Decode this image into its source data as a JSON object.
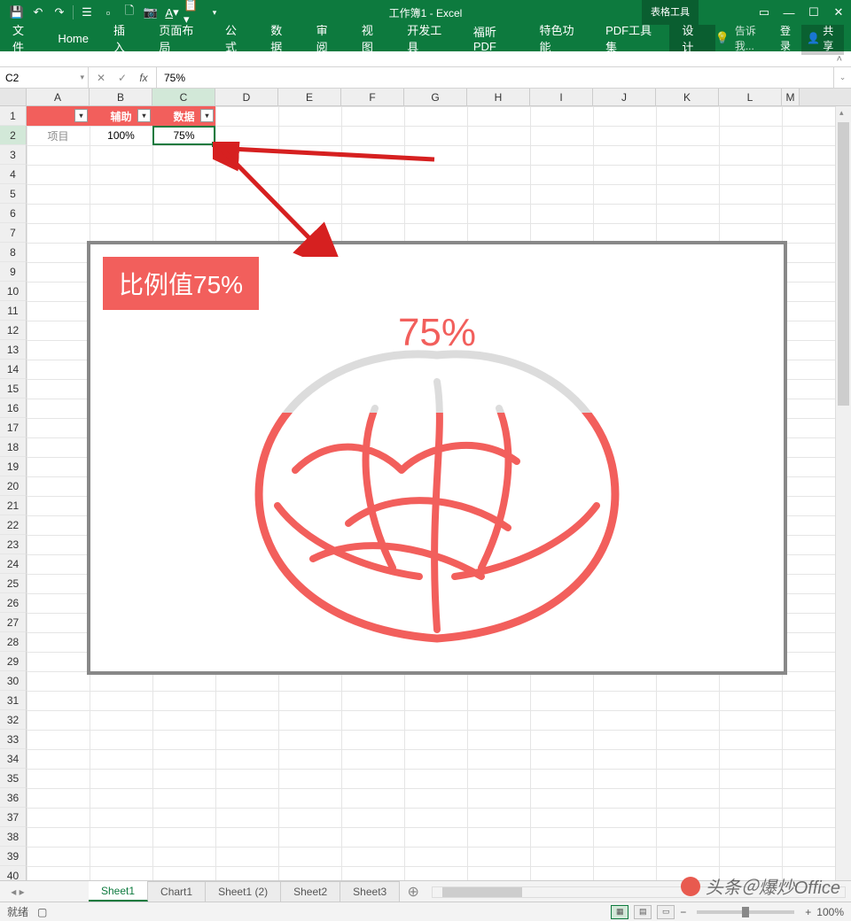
{
  "app": {
    "title": "工作簿1 - Excel",
    "table_tools": "表格工具"
  },
  "qat": {
    "save": "save",
    "undo": "undo",
    "redo": "redo"
  },
  "ribbon": {
    "tabs": [
      "文件",
      "Home",
      "插入",
      "页面布局",
      "公式",
      "数据",
      "审阅",
      "视图",
      "开发工具",
      "福昕PDF",
      "特色功能",
      "PDF工具集",
      "设计"
    ],
    "tell_me": "告诉我...",
    "login": "登录",
    "share": "共享"
  },
  "formula_bar": {
    "name_box": "C2",
    "value": "75%"
  },
  "columns": [
    "A",
    "B",
    "C",
    "D",
    "E",
    "F",
    "G",
    "H",
    "I",
    "J",
    "K",
    "L",
    "M"
  ],
  "table": {
    "headers": [
      "",
      "辅助",
      "数据"
    ],
    "row": {
      "a": "项目",
      "b": "100%",
      "c": "75%"
    }
  },
  "selection": {
    "cell": "C2"
  },
  "chart_data": {
    "type": "bar",
    "categories": [
      "项目"
    ],
    "series": [
      {
        "name": "辅助",
        "values": [
          100
        ]
      },
      {
        "name": "数据",
        "values": [
          75
        ]
      }
    ],
    "title": "比例值75%",
    "data_label": "75%",
    "ylim": [
      0,
      100
    ],
    "fill_percent": 75
  },
  "sheets": {
    "active": "Sheet1",
    "tabs": [
      "Sheet1",
      "Chart1",
      "Sheet1 (2)",
      "Sheet2",
      "Sheet3"
    ]
  },
  "status": {
    "ready": "就绪",
    "zoom": "100%",
    "plus": "+",
    "minus": "−"
  },
  "watermark": {
    "text": "头条＠爆炒Office"
  }
}
